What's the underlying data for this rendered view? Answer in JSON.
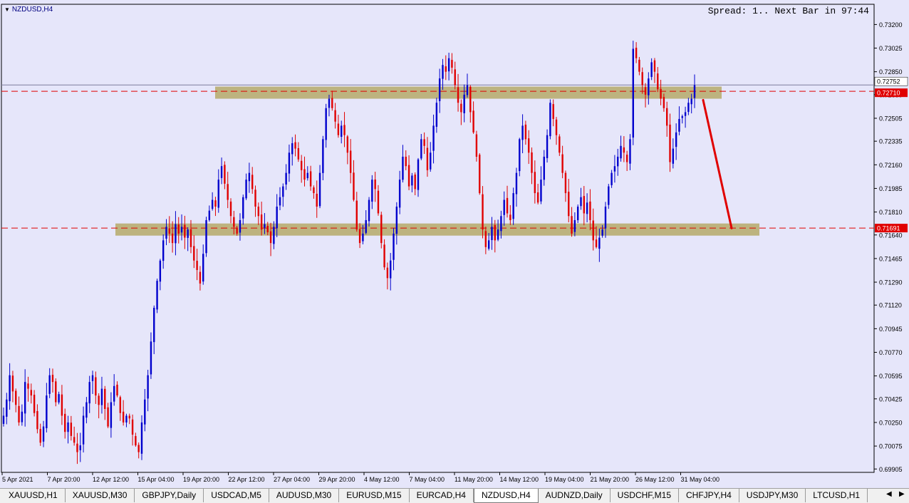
{
  "window": {
    "symbol_label": "NZDUSD,H4",
    "spread_text": "Spread: 1.. Next Bar in 97:44"
  },
  "colors": {
    "background": "#e6e6fa",
    "bull": "#0000cd",
    "bear": "#e00000",
    "zone": "#b5a968",
    "level_line": "#e00000",
    "arrow": "#e00000"
  },
  "chart_data": {
    "type": "candlestick",
    "symbol": "NZDUSD",
    "timeframe": "H4",
    "ylim": [
      0.6988,
      0.7335
    ],
    "y_ticks": [
      "0.73200",
      "0.73025",
      "0.72850",
      "0.72680",
      "0.72505",
      "0.72335",
      "0.72160",
      "0.71985",
      "0.71810",
      "0.71640",
      "0.71465",
      "0.71290",
      "0.71120",
      "0.70945",
      "0.70770",
      "0.70595",
      "0.70425",
      "0.70250",
      "0.70075",
      "0.69905"
    ],
    "x_tick_labels": [
      "5 Apr 2021",
      "7 Apr 20:00",
      "12 Apr 12:00",
      "15 Apr 04:00",
      "19 Apr 20:00",
      "22 Apr 12:00",
      "27 Apr 04:00",
      "29 Apr 20:00",
      "4 May 12:00",
      "7 May 04:00",
      "11 May 20:00",
      "14 May 12:00",
      "19 May 04:00",
      "21 May 20:00",
      "26 May 12:00",
      "31 May 04:00"
    ],
    "price_labels": [
      {
        "text": "0.72752",
        "value": 0.72752,
        "style": "plain"
      },
      {
        "text": "0.72710",
        "value": 0.7271,
        "style": "highlight"
      },
      {
        "text": "0.71691",
        "value": 0.71691,
        "style": "highlight"
      }
    ],
    "horizontal_levels": [
      0.72705,
      0.71691
    ],
    "current_price": 0.72752,
    "zones": [
      {
        "label": "resistance",
        "low": 0.7265,
        "high": 0.7274
      },
      {
        "label": "support",
        "low": 0.71635,
        "high": 0.71725
      }
    ],
    "closes": [
      0.703,
      0.7042,
      0.706,
      0.7048,
      0.7038,
      0.7025,
      0.7033,
      0.7055,
      0.705,
      0.7045,
      0.7032,
      0.702,
      0.701,
      0.7022,
      0.7045,
      0.706,
      0.7055,
      0.704,
      0.7046,
      0.703,
      0.7018,
      0.7025,
      0.7015,
      0.701,
      0.7003,
      0.7008,
      0.703,
      0.704,
      0.7055,
      0.706,
      0.7045,
      0.7038,
      0.705,
      0.7035,
      0.7022,
      0.704,
      0.7052,
      0.7045,
      0.7032,
      0.7025,
      0.703,
      0.7028,
      0.7016,
      0.7008,
      0.7003,
      0.7025,
      0.7042,
      0.706,
      0.7085,
      0.711,
      0.713,
      0.7145,
      0.716,
      0.717,
      0.7165,
      0.7158,
      0.7172,
      0.7165,
      0.717,
      0.7162,
      0.7168,
      0.7155,
      0.7145,
      0.7138,
      0.7128,
      0.715,
      0.7175,
      0.7182,
      0.719,
      0.7185,
      0.7205,
      0.7215,
      0.7202,
      0.719,
      0.7178,
      0.717,
      0.7165,
      0.7175,
      0.7192,
      0.7205,
      0.721,
      0.7198,
      0.7185,
      0.7178,
      0.7168,
      0.7172,
      0.7166,
      0.7158,
      0.717,
      0.7185,
      0.7192,
      0.72,
      0.721,
      0.7225,
      0.7232,
      0.7228,
      0.722,
      0.7212,
      0.7205,
      0.721,
      0.72,
      0.7195,
      0.7185,
      0.721,
      0.7235,
      0.7258,
      0.7265,
      0.7258,
      0.7248,
      0.7238,
      0.7245,
      0.7238,
      0.7225,
      0.721,
      0.719,
      0.7168,
      0.7158,
      0.7165,
      0.7175,
      0.719,
      0.7205,
      0.7198,
      0.718,
      0.7158,
      0.714,
      0.7132,
      0.7145,
      0.7165,
      0.7185,
      0.7205,
      0.7222,
      0.7215,
      0.72,
      0.7208,
      0.7198,
      0.722,
      0.7235,
      0.723,
      0.7212,
      0.7225,
      0.7245,
      0.7262,
      0.728,
      0.729,
      0.7285,
      0.7295,
      0.7288,
      0.7275,
      0.7262,
      0.7255,
      0.7268,
      0.7275,
      0.7255,
      0.724,
      0.7222,
      0.7195,
      0.7168,
      0.7155,
      0.716,
      0.717,
      0.716,
      0.7168,
      0.7178,
      0.719,
      0.718,
      0.7175,
      0.7195,
      0.721,
      0.7235,
      0.7245,
      0.7235,
      0.7225,
      0.721,
      0.7195,
      0.7188,
      0.7205,
      0.7222,
      0.7238,
      0.7262,
      0.725,
      0.7238,
      0.7225,
      0.721,
      0.7195,
      0.7178,
      0.7165,
      0.7175,
      0.7185,
      0.7192,
      0.718,
      0.7188,
      0.7175,
      0.716,
      0.7155,
      0.7162,
      0.7168,
      0.7185,
      0.72,
      0.721,
      0.7215,
      0.7222,
      0.723,
      0.7225,
      0.7218,
      0.7235,
      0.7302,
      0.7295,
      0.7285,
      0.7275,
      0.7268,
      0.728,
      0.7292,
      0.7285,
      0.7272,
      0.7265,
      0.7258,
      0.7245,
      0.7218,
      0.7228,
      0.724,
      0.725,
      0.7252,
      0.7255,
      0.7262,
      0.7265,
      0.7275
    ]
  },
  "tabs": [
    {
      "label": "XAUUSD,H1",
      "active": false
    },
    {
      "label": "XAUUSD,M30",
      "active": false
    },
    {
      "label": "GBPJPY,Daily",
      "active": false
    },
    {
      "label": "USDCAD,M5",
      "active": false
    },
    {
      "label": "AUDUSD,M30",
      "active": false
    },
    {
      "label": "EURUSD,M15",
      "active": false
    },
    {
      "label": "EURCAD,H4",
      "active": false
    },
    {
      "label": "NZDUSD,H4",
      "active": true
    },
    {
      "label": "AUDNZD,Daily",
      "active": false
    },
    {
      "label": "USDCHF,M15",
      "active": false
    },
    {
      "label": "CHFJPY,H4",
      "active": false
    },
    {
      "label": "USDJPY,M30",
      "active": false
    },
    {
      "label": "LTCUSD,H1",
      "active": false
    }
  ],
  "scroll": {
    "left_icon": "scroll-left-icon",
    "right_icon": "scroll-right-icon",
    "left_glyph": "◀",
    "right_glyph": "▶"
  }
}
